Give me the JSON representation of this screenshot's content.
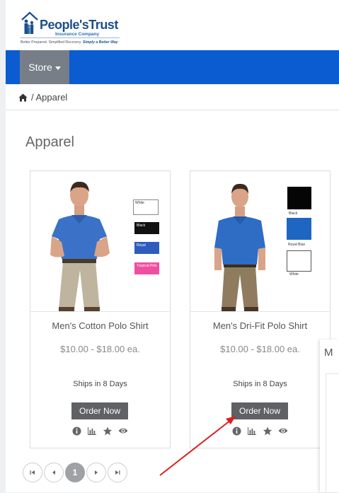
{
  "brand": {
    "name": "People'sTrust",
    "subtitle": "Insurance Company",
    "tagline_lead": "Better Prepared. Simplified Recovery.",
    "tagline_emph": "Simply a Better Way"
  },
  "nav": {
    "store_label": "Store"
  },
  "breadcrumb": {
    "current": "/ Apparel"
  },
  "page": {
    "title": "Apparel"
  },
  "products": [
    {
      "name": "Men's Cotton Polo Shirt",
      "price": "$10.00 - $18.00 ea.",
      "ships": "Ships in 8 Days",
      "order_label": "Order Now",
      "swatches": [
        "White",
        "Black",
        "Royal",
        "Tropical Pink"
      ]
    },
    {
      "name": "Men's Dri-Fit Polo Shirt",
      "price": "$10.00 - $18.00 ea.",
      "ships": "Ships in 8 Days",
      "order_label": "Order Now",
      "swatches": [
        "Black",
        "Royal Blue",
        "White"
      ]
    }
  ],
  "pager": {
    "current_page": "1"
  },
  "side_panel": {
    "text": "M"
  },
  "colors": {
    "nav_blue": "#0b5cd0",
    "store_gray": "#777e87",
    "button_gray": "#5f6164",
    "shirt_blue": "#2f6cc4",
    "annotation_red": "#d9201f"
  }
}
